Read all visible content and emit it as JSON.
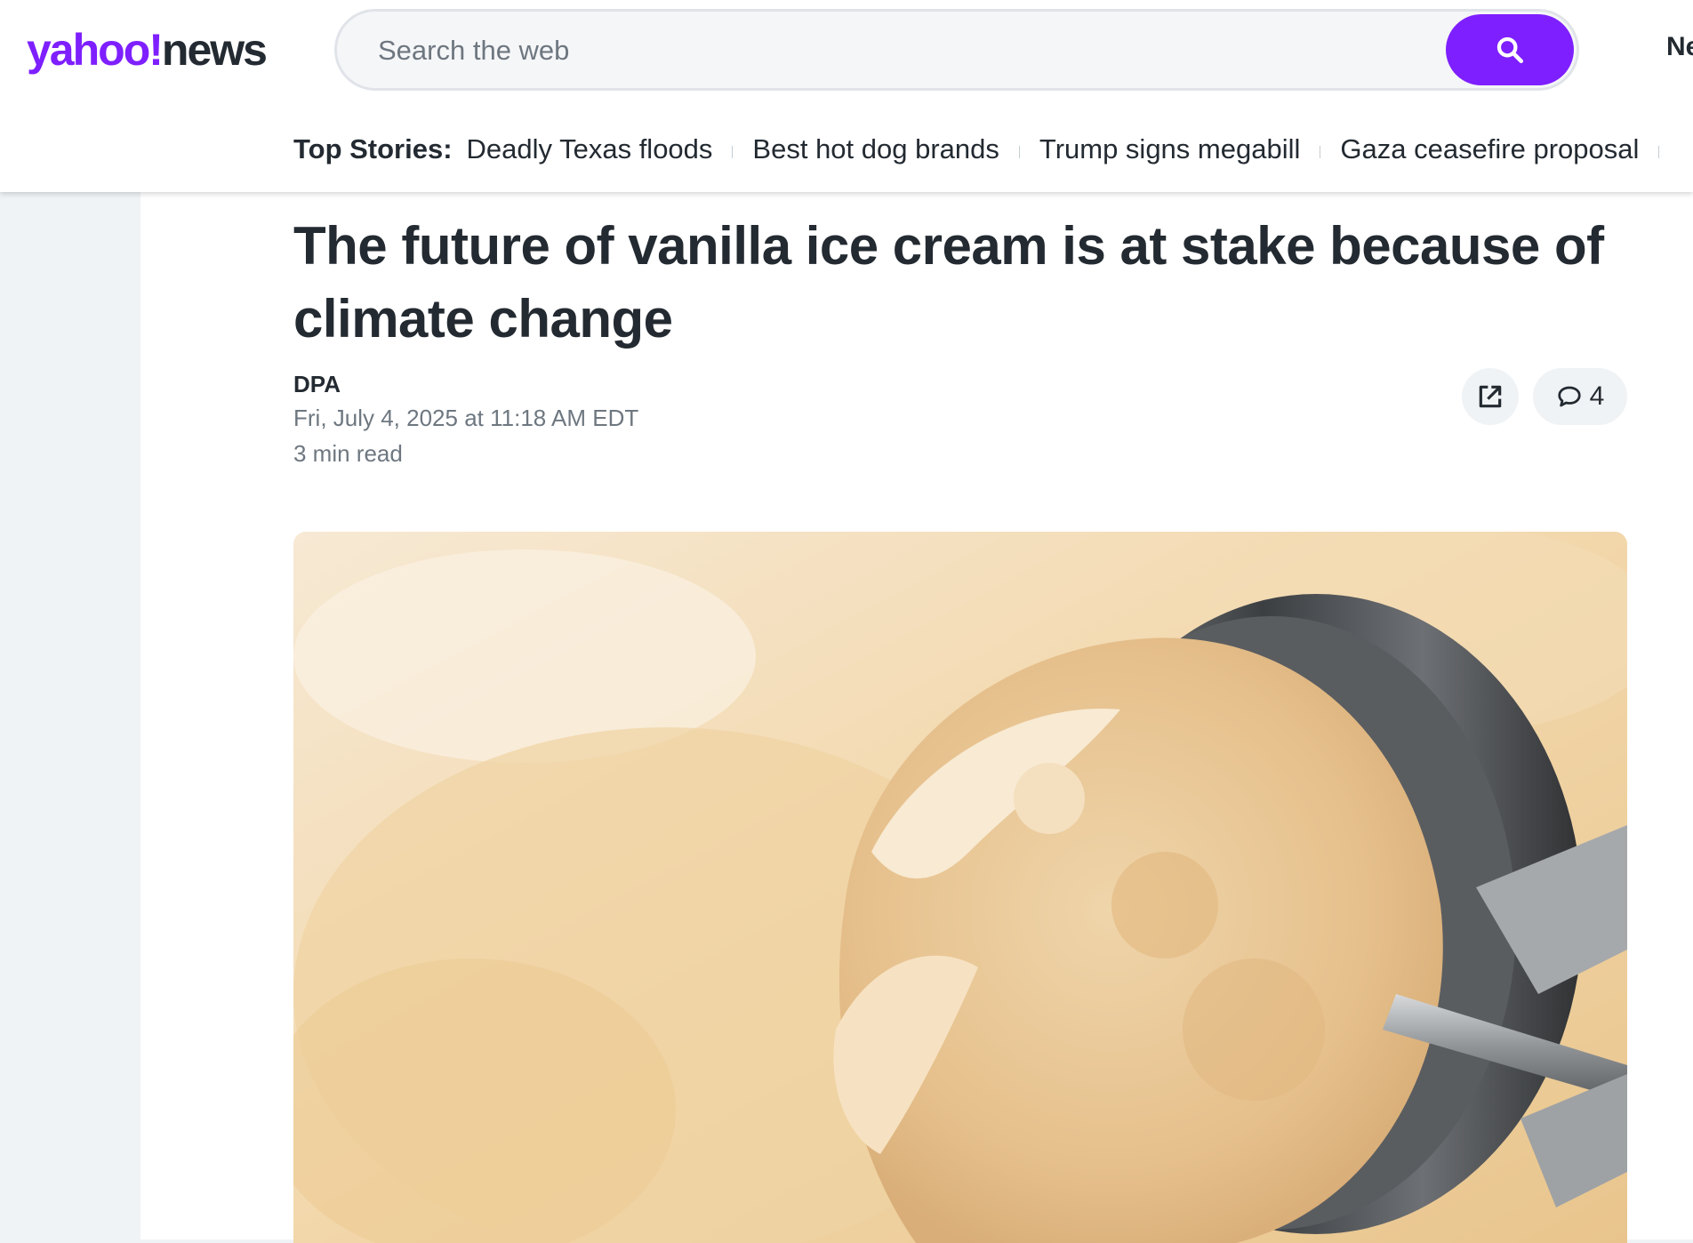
{
  "header": {
    "logo_brand": "yahoo!",
    "logo_product": "news",
    "search_placeholder": "Search the web",
    "right_link_partial": "Ne"
  },
  "top_stories": {
    "label": "Top Stories:",
    "items": [
      "Deadly Texas floods",
      "Best hot dog brands",
      "Trump signs megabill",
      "Gaza ceasefire proposal"
    ]
  },
  "article": {
    "title": "The future of vanilla ice cream is at stake because of climate change",
    "author": "DPA",
    "published": "Fri, July 4, 2025 at 11:18 AM EDT",
    "read_time": "3 min read",
    "comment_count": "4",
    "hero_image": "vanilla-ice-cream-scoop-photo"
  },
  "icons": {
    "search": "search-icon",
    "share": "external-share-icon",
    "comments": "comment-bubble-icon"
  },
  "colors": {
    "brand_purple": "#7e1fff",
    "text_primary": "#232a31",
    "text_secondary": "#6e7780",
    "page_bg": "#f0f3f5"
  }
}
